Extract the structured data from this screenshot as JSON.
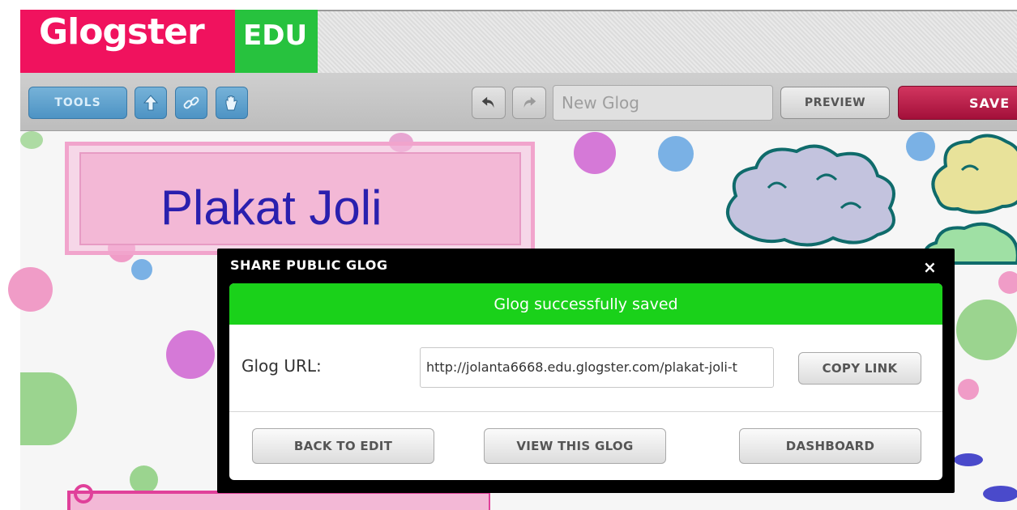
{
  "header": {
    "logo_text": "Glogster",
    "logo_badge": "EDU"
  },
  "toolbar": {
    "tools_label": "TOOLS",
    "title_placeholder": "New Glog",
    "preview_label": "PREVIEW",
    "save_label": "SAVE",
    "icons": [
      "upload-arrow-icon",
      "link-icon",
      "hand-icon",
      "undo-icon",
      "redo-icon"
    ]
  },
  "canvas": {
    "glog_title": "Plakat Joli"
  },
  "modal": {
    "title": "SHARE PUBLIC GLOG",
    "close_glyph": "×",
    "success_message": "Glog successfully saved",
    "url_label": "Glog URL:",
    "url_value": "http://jolanta6668.edu.glogster.com/plakat-joli-t",
    "copy_link_label": "COPY LINK",
    "back_to_edit_label": "BACK TO EDIT",
    "view_glog_label": "VIEW THIS GLOG",
    "dashboard_label": "DASHBOARD"
  },
  "colors": {
    "logo_pink": "#f0125e",
    "logo_green": "#27c23e",
    "tools_blue": "#4d93c4",
    "save_red": "#a3103a",
    "success_green": "#1ad11a"
  }
}
